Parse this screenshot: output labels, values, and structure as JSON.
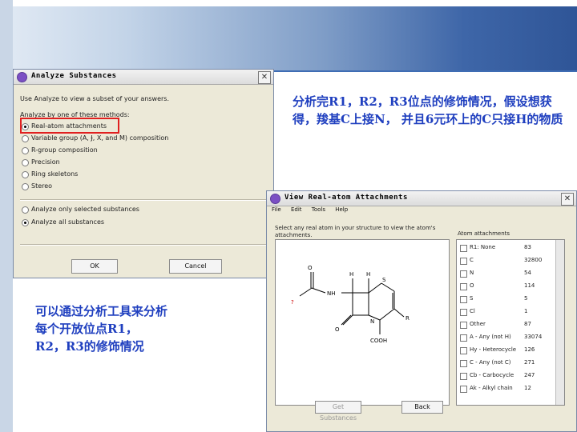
{
  "dialog1": {
    "title": "Analyze Substances",
    "close": "✕",
    "instruction": "Use Analyze to view a subset of your answers.",
    "method_prompt": "Analyze by one of these methods:",
    "methods": [
      "Real-atom attachments",
      "Variable group (A, Ɉ, X, and M) composition",
      "R-group composition",
      "Precision",
      "Ring skeletons",
      "Stereo"
    ],
    "selected_method": 0,
    "scopes": [
      "Analyze only selected substances",
      "Analyze all substances"
    ],
    "selected_scope": 1,
    "ok": "OK",
    "cancel": "Cancel"
  },
  "dialog2": {
    "title": "View Real-atom Attachments",
    "close": "✕",
    "menu": [
      "File",
      "Edit",
      "Tools",
      "Help"
    ],
    "instruction_line1": "Select any real atom in your structure to view the atom's",
    "instruction_line2": "attachments.",
    "list_header": "Atom attachments",
    "list": [
      {
        "label": "R1: None",
        "value": "83"
      },
      {
        "label": "C",
        "value": "32800"
      },
      {
        "label": "N",
        "value": "54"
      },
      {
        "label": "O",
        "value": "114"
      },
      {
        "label": "S",
        "value": "5"
      },
      {
        "label": "Cl",
        "value": "1"
      },
      {
        "label": "Other",
        "value": "87"
      },
      {
        "label": "A - Any (not H)",
        "value": "33074"
      },
      {
        "label": "Hy - Heterocycle",
        "value": "126"
      },
      {
        "label": "C - Any (not C)",
        "value": "271"
      },
      {
        "label": "Cb - Carbocycle",
        "value": "247"
      },
      {
        "label": "Ak - Alkyl chain",
        "value": "12"
      }
    ],
    "get_substances": "Get Substances",
    "back": "Back",
    "molecule_labels": {
      "nh": "NH",
      "h1": "H",
      "h2": "H",
      "s": "S",
      "n": "N",
      "o1": "O",
      "o2": "O",
      "q": "?",
      "r": "R",
      "cooh": "COOH"
    }
  },
  "notes": {
    "right": "分析完R1，R2，R3位点的修饰情况，假设想获得，羧基C上接N， 并且6元环上的C只接H的物质",
    "left": "可以通过分析工具来分析每个开放位点R1，R2，R3的修饰情况"
  },
  "colors": {
    "note": "#1f3fbf",
    "highlight": "#e02020",
    "banner_dark": "#2f5597"
  }
}
